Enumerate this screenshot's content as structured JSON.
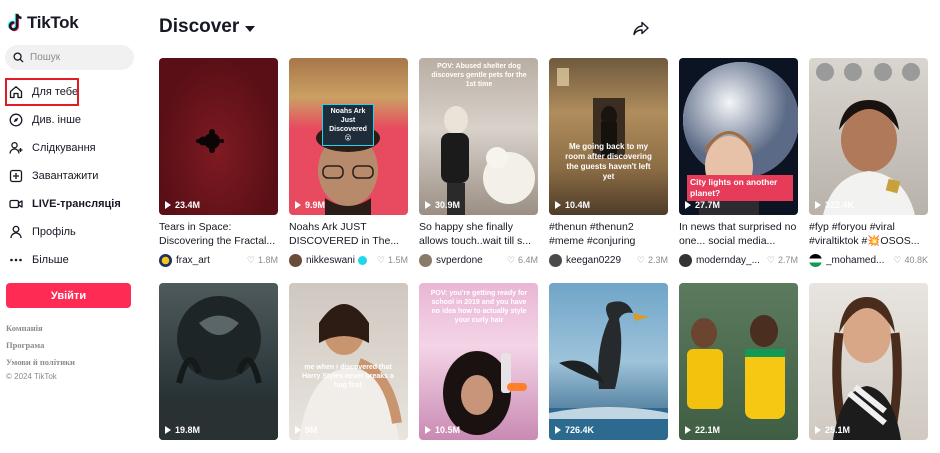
{
  "sidebar": {
    "logo": "TikTok",
    "search_placeholder": "Пошук",
    "nav": [
      {
        "label": "Для тебе",
        "icon": "home-icon",
        "active": true
      },
      {
        "label": "Див. інше",
        "icon": "compass-icon"
      },
      {
        "label": "Слідкування",
        "icon": "user-follow-icon"
      },
      {
        "label": "Завантажити",
        "icon": "upload-icon"
      },
      {
        "label": "LIVE-трансляція",
        "icon": "live-icon"
      },
      {
        "label": "Профіль",
        "icon": "profile-icon"
      },
      {
        "label": "Більше",
        "icon": "more-icon"
      }
    ],
    "login_label": "Увійти",
    "footer_links": [
      "Компанія",
      "Програма",
      "Умови й політики"
    ],
    "copyright": "© 2024 TikTok"
  },
  "header": {
    "title": "Discover",
    "share_icon": "share-icon"
  },
  "videos": [
    {
      "views": "23.4M",
      "caption": "Tears in Space: Discovering the Fractal...",
      "author": "frax_art",
      "verified": false,
      "likes": "1.8M",
      "overlay": ""
    },
    {
      "views": "9.9M",
      "caption": "Noahs Ark JUST DISCOVERED in The...",
      "author": "nikkeswani",
      "verified": true,
      "likes": "1.5M",
      "overlay": "Noahs Ark Just Discovered 😮"
    },
    {
      "views": "30.9M",
      "caption": "So happy she finally allows touch..wait till s...",
      "author": "svperdone",
      "verified": false,
      "likes": "6.4M",
      "overlay": "POV: Abused shelter dog discovers gentle pets for the 1st time"
    },
    {
      "views": "10.4M",
      "caption": "#thenun #thenun2 #meme #conjuring",
      "author": "keegan0229",
      "verified": false,
      "likes": "2.3M",
      "overlay": "Me going back to my room after discovering the guests haven't left yet"
    },
    {
      "views": "27.7M",
      "caption": "In news that surprised no one... social media...",
      "author": "modernday_...",
      "verified": false,
      "likes": "2.7M",
      "overlay": "City lights on another planet?"
    },
    {
      "views": "322.4K",
      "caption": "#fyp #foryou #viral #viraltiktok #💥OSOS...",
      "author": "_mohamed...",
      "verified": false,
      "likes": "40.8K",
      "overlay": ""
    },
    {
      "views": "19.8M",
      "caption": "",
      "author": "",
      "verified": false,
      "likes": "",
      "overlay": ""
    },
    {
      "views": "9M",
      "caption": "",
      "author": "",
      "verified": false,
      "likes": "",
      "overlay": "me when i discovered that Harry Styles never breaks a hug first"
    },
    {
      "views": "10.5M",
      "caption": "",
      "author": "",
      "verified": false,
      "likes": "",
      "overlay": "POV: you're getting ready for school in 2019 and you have no idea how to actually style your curly hair"
    },
    {
      "views": "726.4K",
      "caption": "",
      "author": "",
      "verified": false,
      "likes": "",
      "overlay": ""
    },
    {
      "views": "22.1M",
      "caption": "",
      "author": "",
      "verified": false,
      "likes": "",
      "overlay": ""
    },
    {
      "views": "25.1M",
      "caption": "",
      "author": "",
      "verified": false,
      "likes": "",
      "overlay": ""
    }
  ],
  "colors": {
    "accent": "#fe2c55",
    "highlight_box": "#e31b23",
    "text": "#161823",
    "muted": "#8a8b91"
  }
}
